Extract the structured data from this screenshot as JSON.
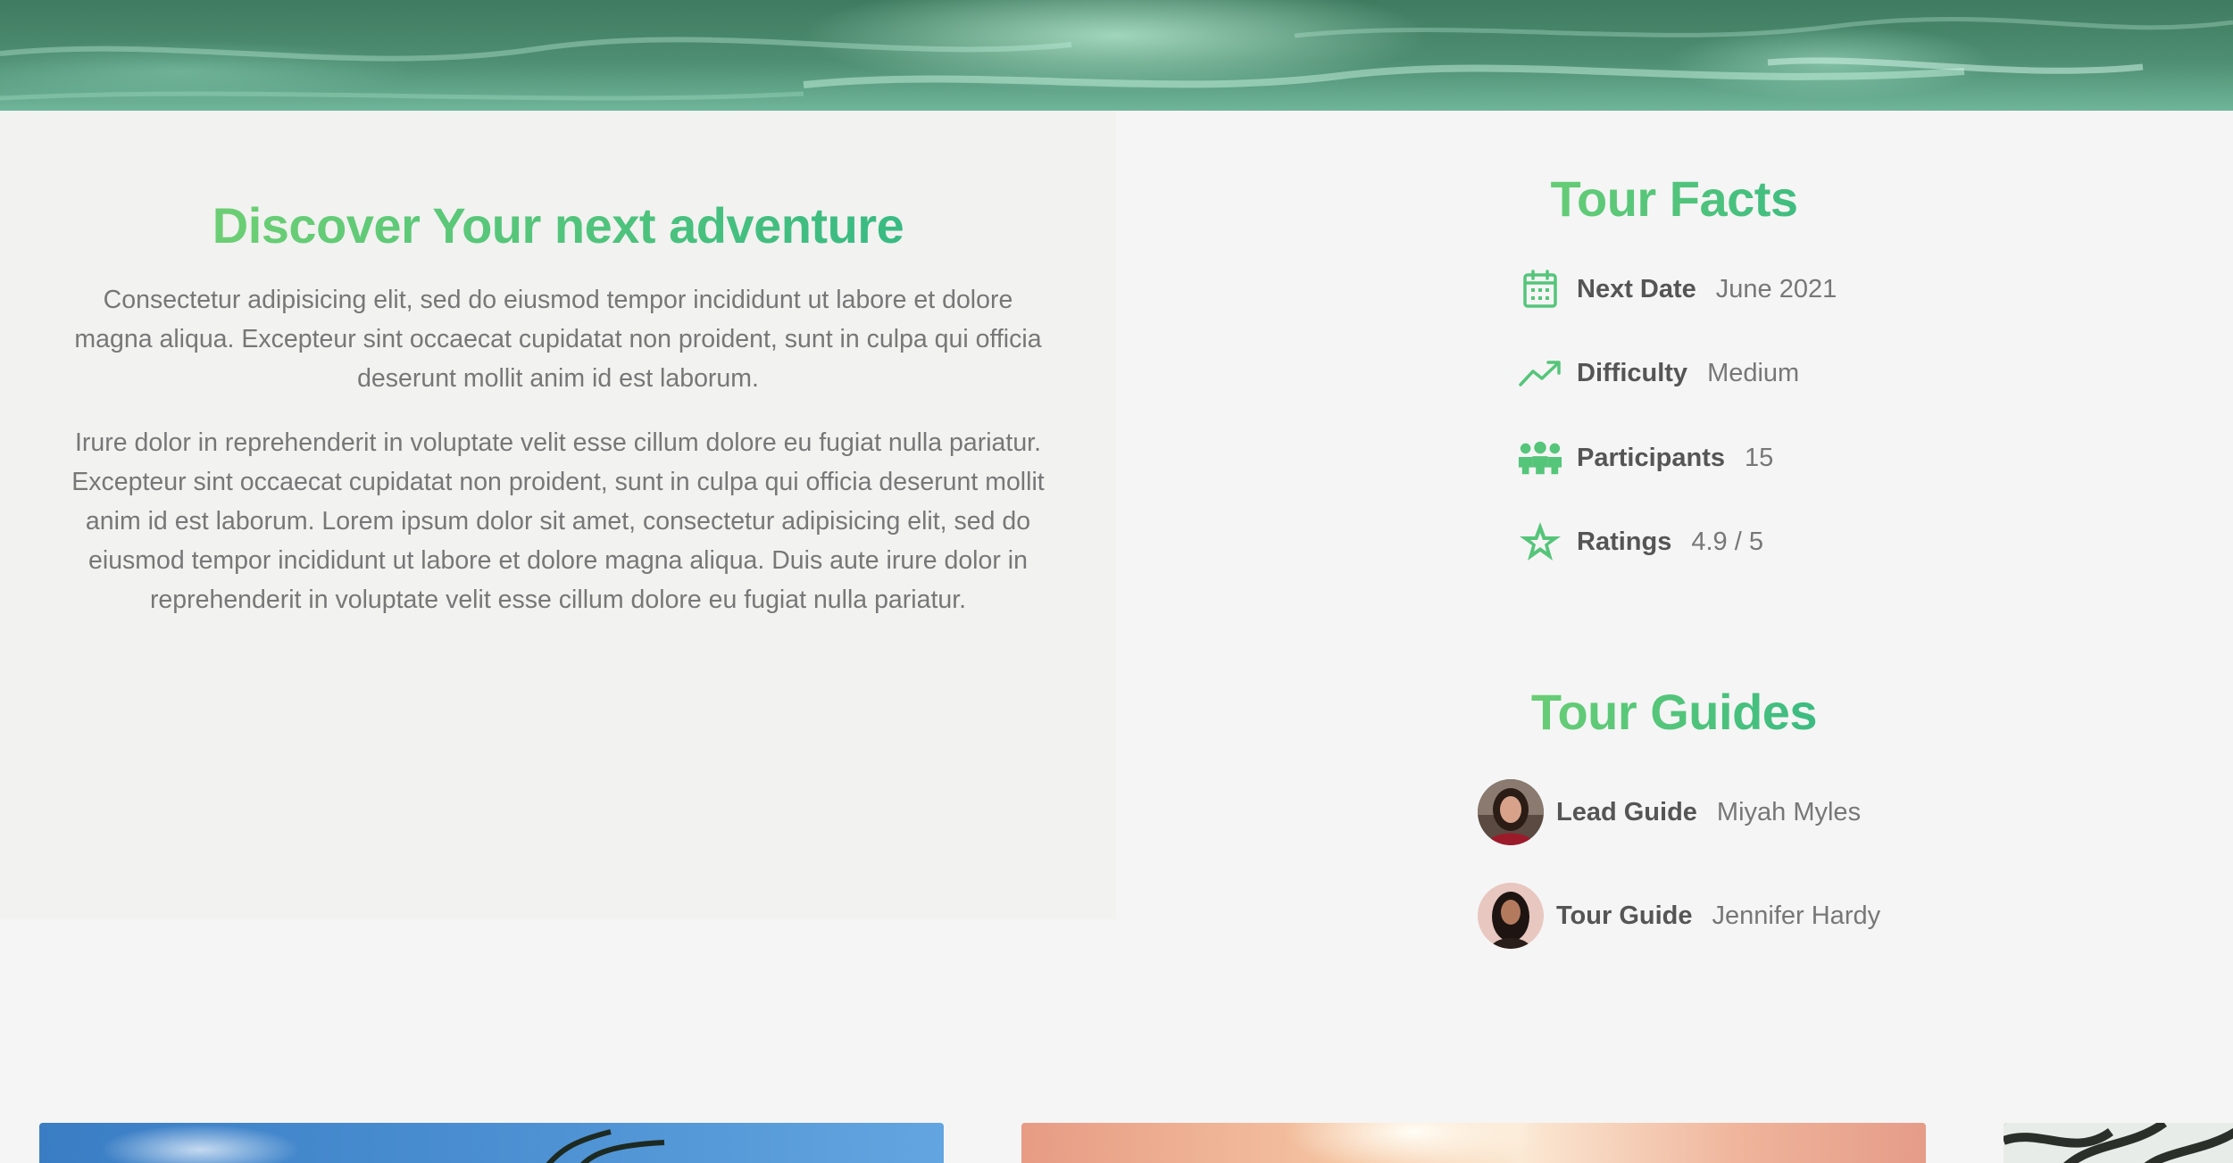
{
  "description": {
    "heading": "Discover Your next adventure",
    "paragraphs": [
      "Consectetur adipisicing elit, sed do eiusmod tempor incididunt ut labore et dolore magna aliqua. Excepteur sint occaecat cupidatat non proident, sunt in culpa qui officia deserunt mollit anim id est laborum.",
      "Irure dolor in reprehenderit in voluptate velit esse cillum dolore eu fugiat nulla pariatur. Excepteur sint occaecat cupidatat non proident, sunt in culpa qui officia deserunt mollit anim id est laborum. Lorem ipsum dolor sit amet, consectetur adipisicing elit, sed do eiusmod tempor incididunt ut labore et dolore magna aliqua. Duis aute irure dolor in reprehenderit in voluptate velit esse cillum dolore eu fugiat nulla pariatur."
    ]
  },
  "facts": {
    "heading": "Tour Facts",
    "items": [
      {
        "icon": "calendar-icon",
        "label": "Next Date",
        "value": "June 2021"
      },
      {
        "icon": "trending-up-icon",
        "label": "Difficulty",
        "value": "Medium"
      },
      {
        "icon": "group-icon",
        "label": "Participants",
        "value": "15"
      },
      {
        "icon": "star-icon",
        "label": "Ratings",
        "value": "4.9 / 5"
      }
    ]
  },
  "guides": {
    "heading": "Tour Guides",
    "items": [
      {
        "role": "Lead Guide",
        "name": "Miyah Myles"
      },
      {
        "role": "Tour Guide",
        "name": "Jennifer Hardy"
      }
    ]
  },
  "theme": {
    "accent": "#55c57a",
    "accent_dark": "#28b487",
    "text": "#777777",
    "label": "#555555"
  }
}
